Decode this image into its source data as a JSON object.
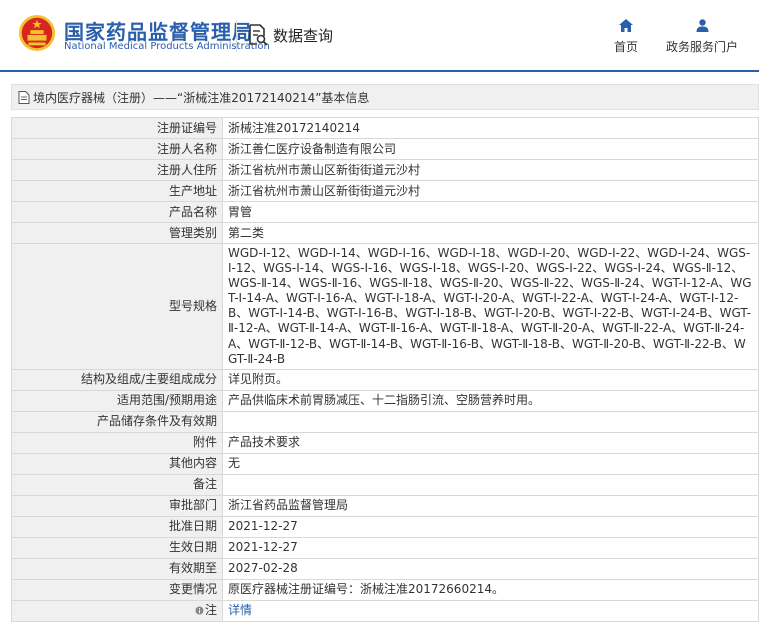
{
  "header": {
    "logo_cn": "国家药品监督管理局",
    "logo_en": "National Medical Products Administration",
    "data_query": "数据查询",
    "nav": {
      "home": "首页",
      "services": "政务服务门户"
    },
    "colors": {
      "brand": "#2a5fab",
      "emblem_red": "#d7261e",
      "emblem_gold": "#f2c230"
    }
  },
  "breadcrumb": "境内医疗器械（注册）——“浙械注准20172140214”基本信息",
  "fields": [
    {
      "key": "注册证编号",
      "value": "浙械注准20172140214"
    },
    {
      "key": "注册人名称",
      "value": "浙江善仁医疗设备制造有限公司"
    },
    {
      "key": "注册人住所",
      "value": "浙江省杭州市萧山区新街街道元沙村"
    },
    {
      "key": "生产地址",
      "value": "浙江省杭州市萧山区新街街道元沙村"
    },
    {
      "key": "产品名称",
      "value": "胃管"
    },
    {
      "key": "管理类别",
      "value": "第二类"
    },
    {
      "key": "型号规格",
      "value": "WGD-Ⅰ-12、WGD-Ⅰ-14、WGD-Ⅰ-16、WGD-Ⅰ-18、WGD-Ⅰ-20、WGD-Ⅰ-22、WGD-Ⅰ-24、WGS-Ⅰ-12、WGS-Ⅰ-14、WGS-Ⅰ-16、WGS-Ⅰ-18、WGS-Ⅰ-20、WGS-Ⅰ-22、WGS-Ⅰ-24、WGS-Ⅱ-12、WGS-Ⅱ-14、WGS-Ⅱ-16、WGS-Ⅱ-18、WGS-Ⅱ-20、WGS-Ⅱ-22、WGS-Ⅱ-24、WGT-Ⅰ-12-A、WGT-Ⅰ-14-A、WGT-Ⅰ-16-A、WGT-Ⅰ-18-A、WGT-Ⅰ-20-A、WGT-Ⅰ-22-A、WGT-Ⅰ-24-A、WGT-Ⅰ-12-B、WGT-Ⅰ-14-B、WGT-Ⅰ-16-B、WGT-Ⅰ-18-B、WGT-Ⅰ-20-B、WGT-Ⅰ-22-B、WGT-Ⅰ-24-B、WGT-Ⅱ-12-A、WGT-Ⅱ-14-A、WGT-Ⅱ-16-A、WGT-Ⅱ-18-A、WGT-Ⅱ-20-A、WGT-Ⅱ-22-A、WGT-Ⅱ-24-A、WGT-Ⅱ-12-B、WGT-Ⅱ-14-B、WGT-Ⅱ-16-B、WGT-Ⅱ-18-B、WGT-Ⅱ-20-B、WGT-Ⅱ-22-B、WGT-Ⅱ-24-B",
      "multi": true
    },
    {
      "key": "结构及组成/主要组成成分",
      "value": "详见附页。"
    },
    {
      "key": "适用范围/预期用途",
      "value": "产品供临床术前胃肠减压、十二指肠引流、空肠营养时用。"
    },
    {
      "key": "产品储存条件及有效期",
      "value": ""
    },
    {
      "key": "附件",
      "value": "产品技术要求"
    },
    {
      "key": "其他内容",
      "value": "无"
    },
    {
      "key": "备注",
      "value": ""
    },
    {
      "key": "审批部门",
      "value": "浙江省药品监督管理局"
    },
    {
      "key": "批准日期",
      "value": "2021-12-27"
    },
    {
      "key": "生效日期",
      "value": "2021-12-27"
    },
    {
      "key": "有效期至",
      "value": "2027-02-28"
    },
    {
      "key": "变更情况",
      "value": "原医疗器械注册证编号：浙械注准20172660214。"
    },
    {
      "key": "注",
      "value": "详情",
      "icon": "info-icon",
      "link": true
    }
  ]
}
